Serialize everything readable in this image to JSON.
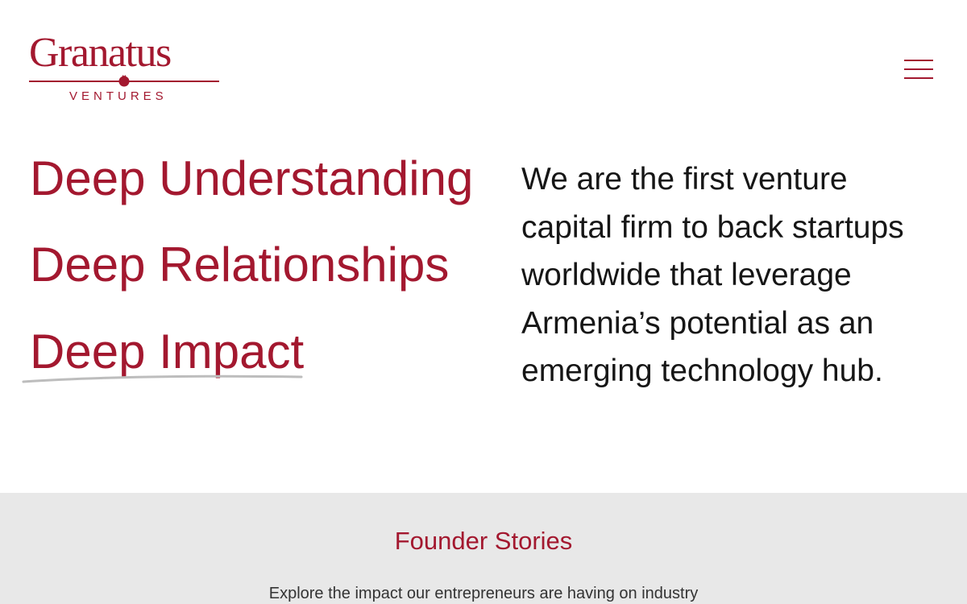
{
  "header": {
    "logo_word": "Granatus",
    "logo_sub": "VENTURES",
    "logo_icon": "pomegranate-icon",
    "menu_icon": "hamburger-menu-icon"
  },
  "hero": {
    "taglines": [
      "Deep Understanding",
      "Deep Relationships",
      "Deep Impact"
    ],
    "body": "We are the first venture capital firm to back startups worldwide that leverage Armenia’s potential as an emerging technology hub."
  },
  "founder_stories": {
    "title": "Founder Stories",
    "description": "Explore the impact our entrepreneurs are having on industry"
  },
  "colors": {
    "brand": "#a3182f",
    "text": "#161616",
    "band": "#e8e8e8",
    "underline": "#bdbdbd"
  }
}
